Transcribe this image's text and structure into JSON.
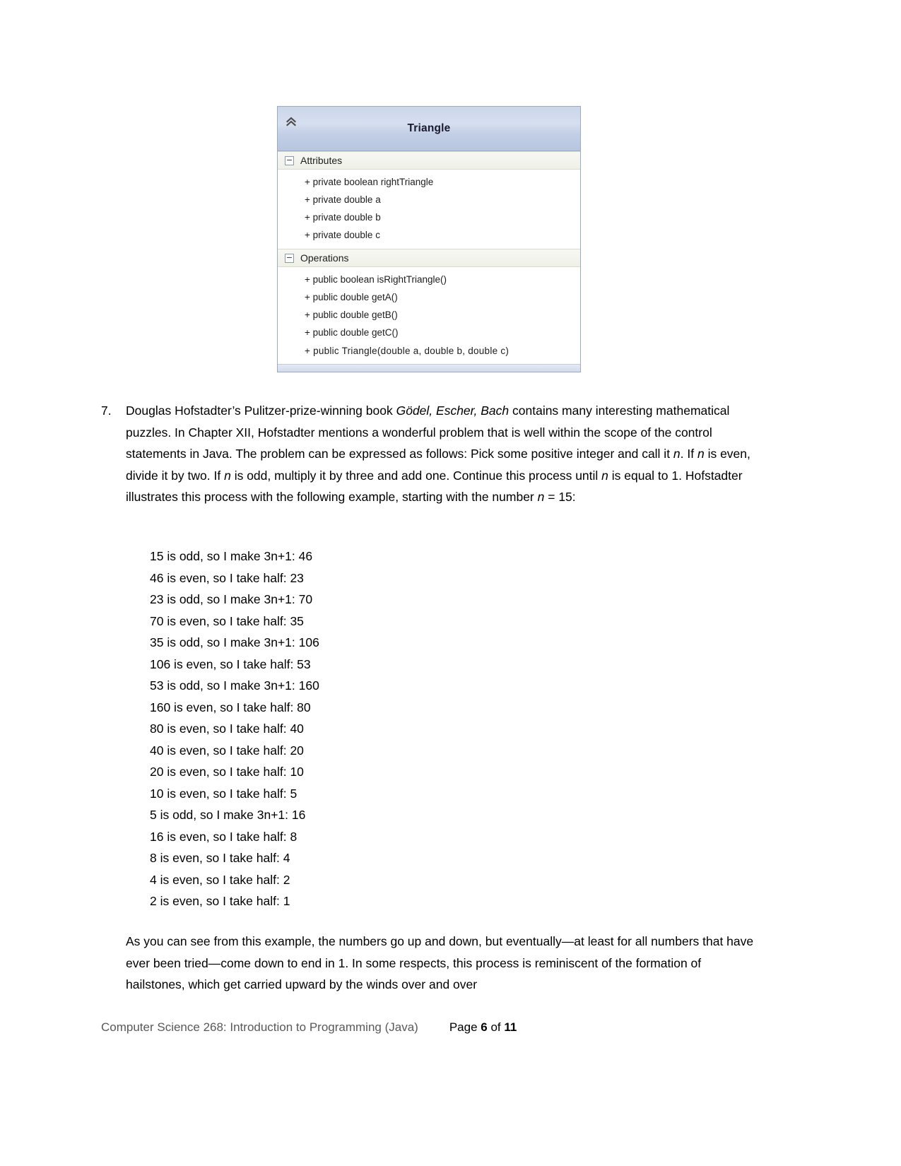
{
  "uml": {
    "title": "Triangle",
    "collapse_icon": "double-chevron-up-icon",
    "sections": [
      {
        "label": "Attributes",
        "members": [
          "+ private boolean rightTriangle",
          "+ private double a",
          "+ private double b",
          "+ private double c"
        ]
      },
      {
        "label": "Operations",
        "members": [
          "+ public boolean isRightTriangle()",
          "+ public double getA()",
          "+ public double getB()",
          "+ public double getC()",
          "+ public Triangle(double a, double b, double c)"
        ]
      }
    ],
    "colors": {
      "header_top": "#ccd6ea",
      "header_bottom": "#b7c5e0",
      "border": "#9aabc4",
      "section_bg": "#f3f4ec"
    }
  },
  "question": {
    "number": "7.",
    "paragraph_part1": "Douglas Hofstadter’s Pulitzer-prize-winning book ",
    "title_italic": "Gödel, Escher, Bach",
    "paragraph_part2": " contains many interesting mathematical puzzles. In Chapter XII, Hofstadter mentions a wonderful problem that is well within the scope of the control statements in Java. The problem can be expressed as follows: Pick some positive integer and call it ",
    "var1": "n",
    "paragraph_part3": ". If ",
    "var2": "n",
    "paragraph_part4": " is even, divide it by two. If ",
    "var3": "n",
    "paragraph_part5": " is odd, multiply it by three and add one. Continue this process until ",
    "var4": "n",
    "paragraph_part6": " is equal to 1. Hofstadter illustrates this process with the following example, starting with the number ",
    "var5": "n",
    "paragraph_part7": " = 15:"
  },
  "sequence": [
    "15 is odd, so I make 3n+1: 46",
    "46 is even, so I take half: 23",
    "23 is odd, so I make 3n+1: 70",
    "70 is even, so I take half: 35",
    "35 is odd, so I make 3n+1: 106",
    "106 is even, so I take half: 53",
    "53 is odd, so I make 3n+1: 160",
    "160 is even, so I take half: 80",
    "80 is even, so I take half: 40",
    "40 is even, so I take half: 20",
    "20 is even, so I take half: 10",
    "10 is even, so I take half: 5",
    "5 is odd, so I make 3n+1: 16",
    "16 is even, so I take half: 8",
    "8 is even, so I take half: 4",
    "4 is even, so I take half: 2",
    "2 is even, so I take half: 1"
  ],
  "closing_paragraph": "As you can see from this example, the numbers go up and down, but eventually—at least for all numbers that have ever been tried—come down to end in 1. In some respects, this process is reminiscent of the formation of hailstones, which get carried upward by the winds over and over",
  "footer": {
    "course": "Computer Science 268: Introduction to Programming (Java)",
    "page_prefix": "Page ",
    "page_current": "6",
    "page_mid": " of ",
    "page_total": "11"
  }
}
